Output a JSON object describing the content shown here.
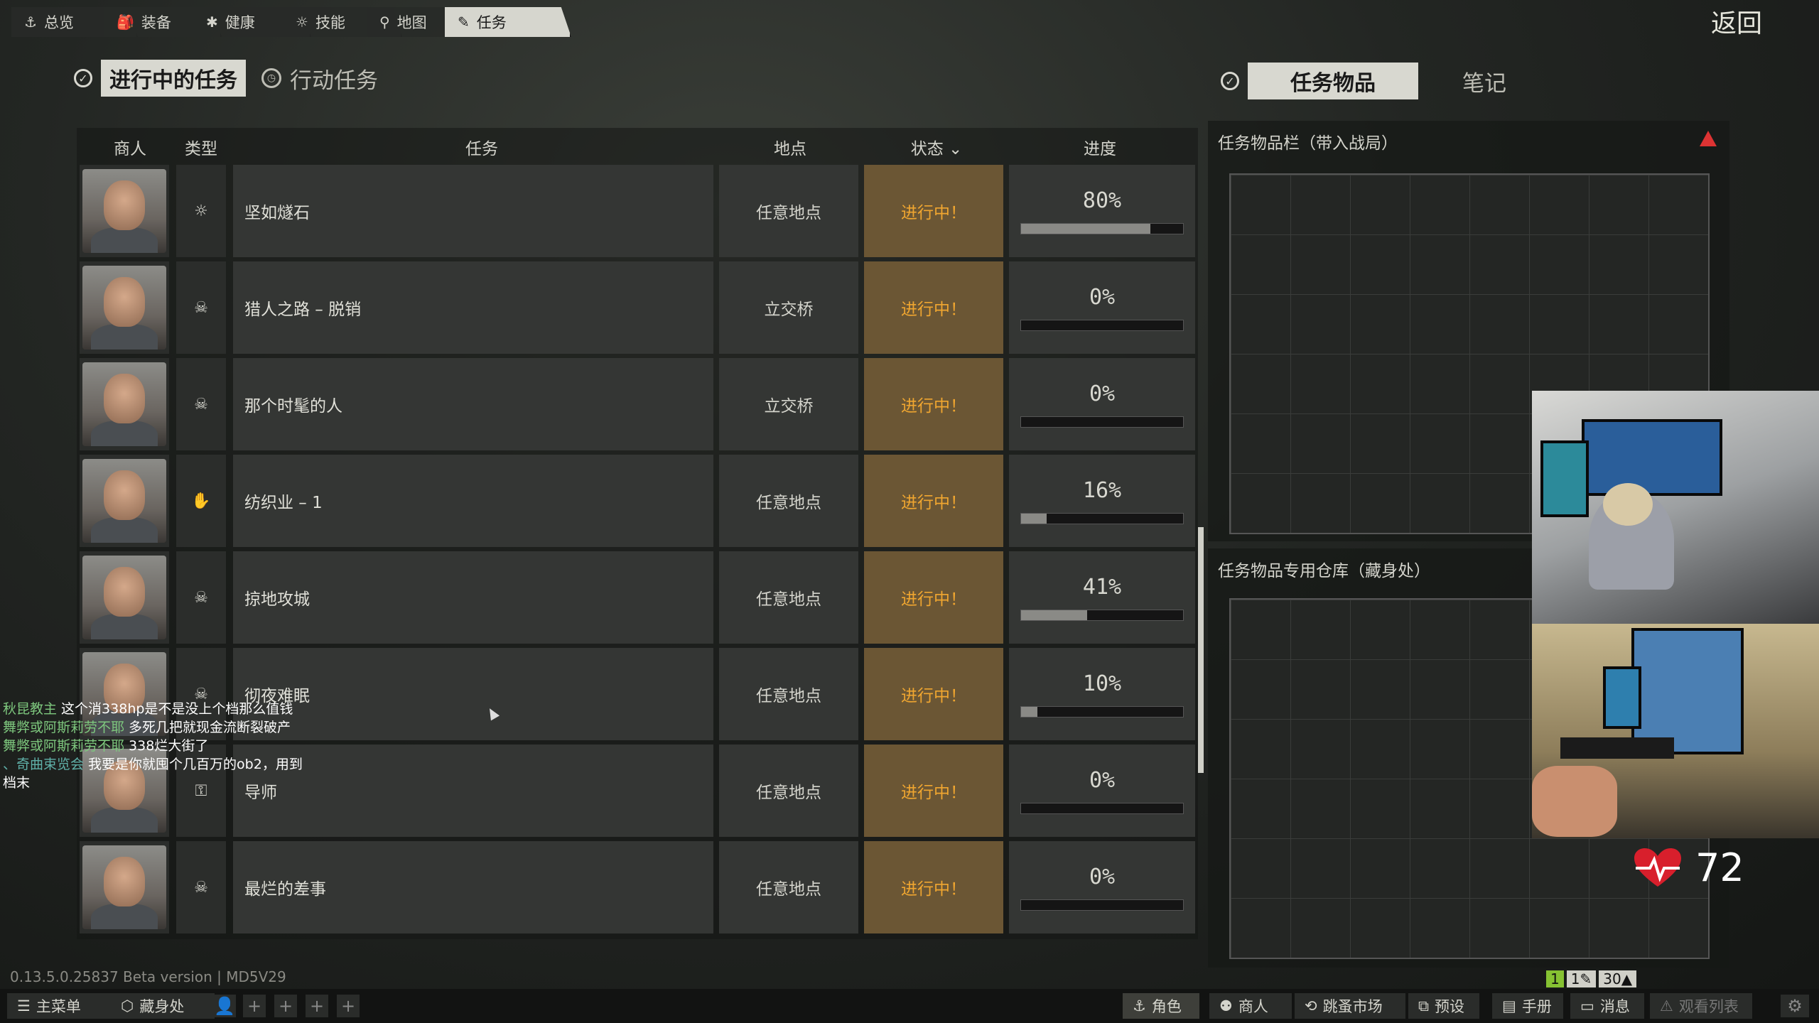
{
  "top_tabs": [
    {
      "label": "总览",
      "icon": "anchor-icon",
      "glyph": "⚓"
    },
    {
      "label": "装备",
      "icon": "gear-icon",
      "glyph": "🎒"
    },
    {
      "label": "健康",
      "icon": "health-icon",
      "glyph": "✱"
    },
    {
      "label": "技能",
      "icon": "bulb-icon",
      "glyph": "☼"
    },
    {
      "label": "地图",
      "icon": "map-pin-icon",
      "glyph": "⚲"
    },
    {
      "label": "任务",
      "icon": "edit-icon",
      "glyph": "✎"
    }
  ],
  "back_label": "返回",
  "left_tabs": {
    "active": "进行中的任务",
    "other": "行动任务"
  },
  "right_tabs": {
    "active": "任务物品",
    "other": "笔记"
  },
  "columns": {
    "trader": "商人",
    "type": "类型",
    "task": "任务",
    "location": "地点",
    "status": "状态",
    "status_arrow": "⌄",
    "progress": "进度"
  },
  "quests": [
    {
      "type_icon": "☼",
      "name": "坚如燧石",
      "location": "任意地点",
      "status": "进行中！",
      "progress_text": "80%",
      "progress": 0.8
    },
    {
      "type_icon": "☠",
      "name": "猎人之路 – 脱销",
      "location": "立交桥",
      "status": "进行中！",
      "progress_text": "0%",
      "progress": 0
    },
    {
      "type_icon": "☠",
      "name": "那个时髦的人",
      "location": "立交桥",
      "status": "进行中！",
      "progress_text": "0%",
      "progress": 0
    },
    {
      "type_icon": "✋",
      "name": "纺织业 – 1",
      "location": "任意地点",
      "status": "进行中！",
      "progress_text": "16%",
      "progress": 0.16
    },
    {
      "type_icon": "☠",
      "name": "掠地攻城",
      "location": "任意地点",
      "status": "进行中！",
      "progress_text": "41%",
      "progress": 0.41
    },
    {
      "type_icon": "☠",
      "name": "彻夜难眠",
      "location": "任意地点",
      "status": "进行中！",
      "progress_text": "10%",
      "progress": 0.1
    },
    {
      "type_icon": "⚿",
      "name": "导师",
      "location": "任意地点",
      "status": "进行中！",
      "progress_text": "0%",
      "progress": 0
    },
    {
      "type_icon": "☠",
      "name": "最烂的差事",
      "location": "任意地点",
      "status": "进行中！",
      "progress_text": "0%",
      "progress": 0
    }
  ],
  "panels": {
    "quest_items": "任务物品栏（带入战局）",
    "stash": "任务物品专用仓库（藏身处）"
  },
  "heart_rate": "72",
  "chat": [
    {
      "user": "秋昆教主",
      "text": " 这个消338hp是不是没上个档那么值钱"
    },
    {
      "user": "舞弊或阿斯莉劳不耶",
      "text": " 多死几把就现金流断裂破产"
    },
    {
      "user": "舞弊或阿斯莉劳不耶",
      "text": " 338烂大街了"
    },
    {
      "user": "、奇曲束览会",
      "text": " 我要是你就囤个几百万的ob2，用到档末"
    }
  ],
  "version": "0.13.5.0.25837 Beta version | MD5V29",
  "bottom": {
    "main_menu": "主菜单",
    "hideout": "藏身处",
    "character": "角色",
    "traders": "商人",
    "flea": "跳蚤市场",
    "presets": "预设",
    "handbook": "手册",
    "messages": "消息",
    "watchlist": "观看列表"
  },
  "counters": [
    "1",
    "1",
    "30"
  ]
}
